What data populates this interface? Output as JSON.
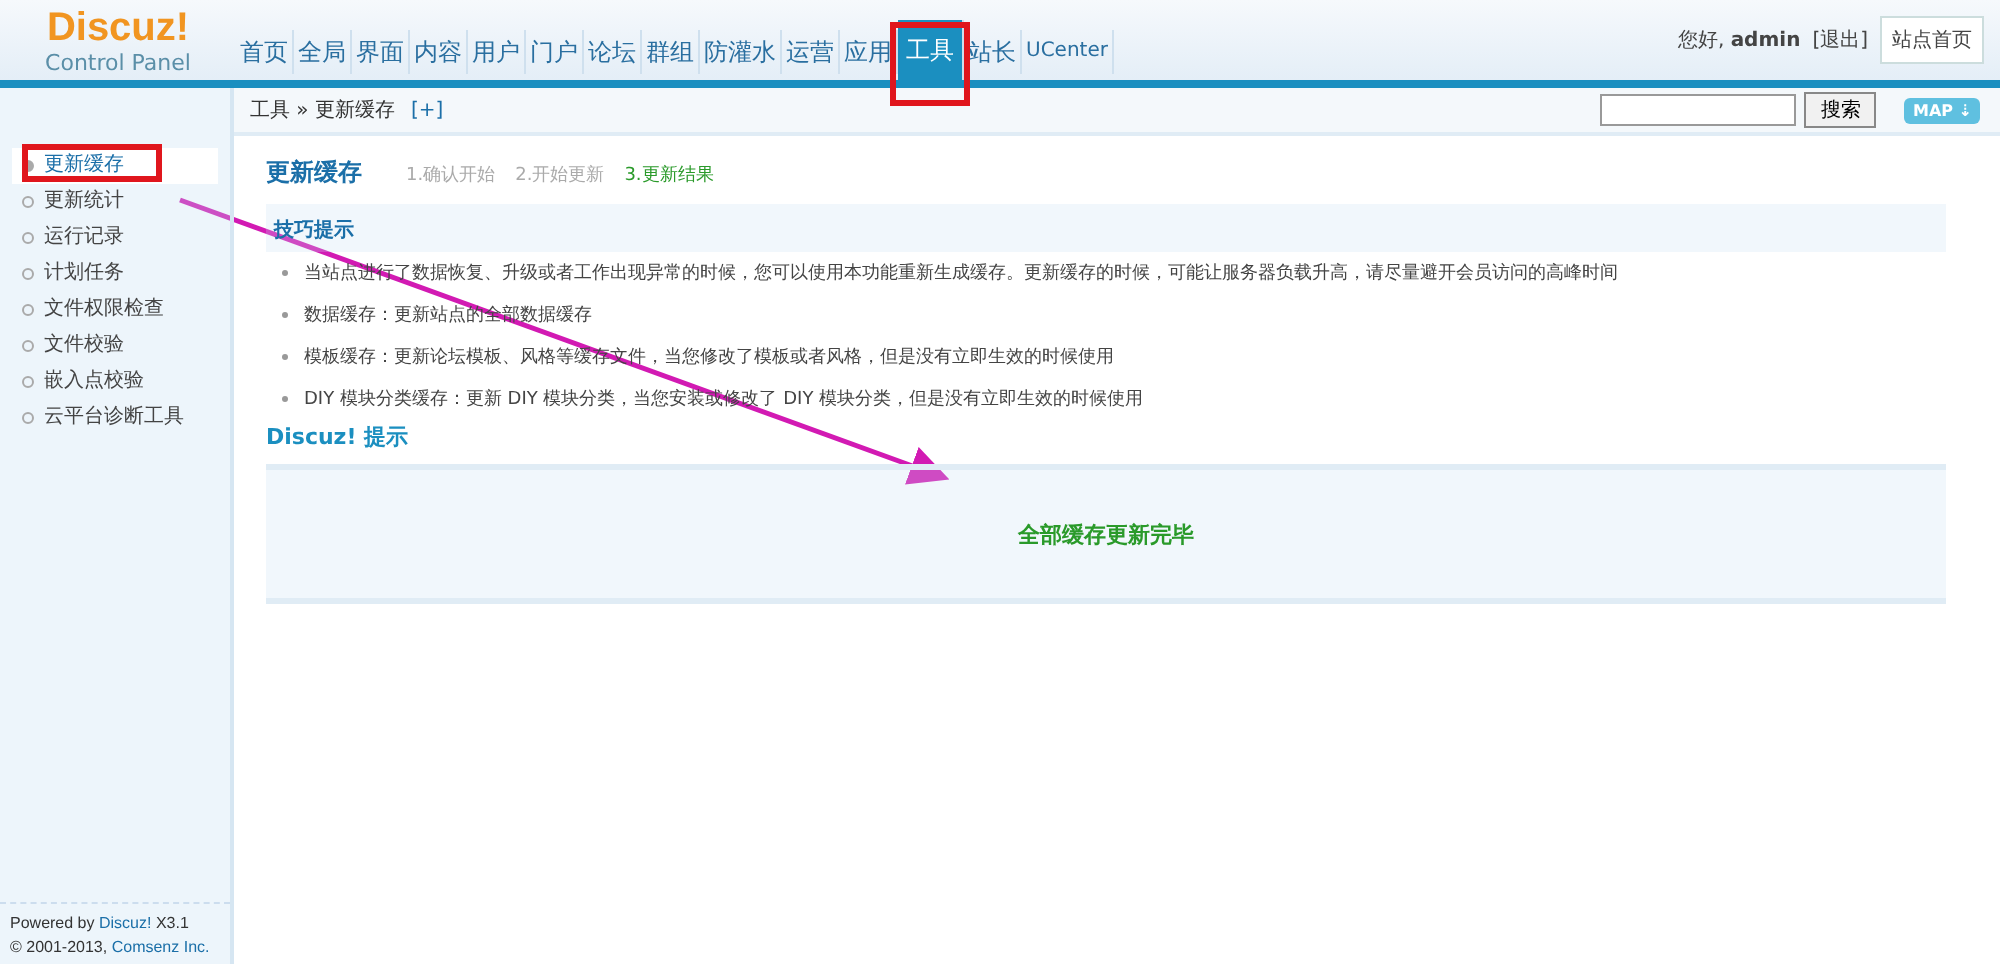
{
  "logo": {
    "name": "Discuz!",
    "subtitle": "Control Panel"
  },
  "nav": [
    {
      "label": "首页",
      "selected": false
    },
    {
      "label": "全局",
      "selected": false
    },
    {
      "label": "界面",
      "selected": false
    },
    {
      "label": "内容",
      "selected": false
    },
    {
      "label": "用户",
      "selected": false
    },
    {
      "label": "门户",
      "selected": false
    },
    {
      "label": "论坛",
      "selected": false
    },
    {
      "label": "群组",
      "selected": false
    },
    {
      "label": "防灌水",
      "selected": false
    },
    {
      "label": "运营",
      "selected": false
    },
    {
      "label": "应用",
      "selected": false
    },
    {
      "label": "工具",
      "selected": true
    },
    {
      "label": "站长",
      "selected": false
    },
    {
      "label": "UCenter",
      "selected": false
    }
  ],
  "user": {
    "greeting": "您好,",
    "name": "admin",
    "logout": "[退出]",
    "home_button": "站点首页"
  },
  "breadcrumb": {
    "path": "工具 » 更新缓存",
    "toggle": "[+]"
  },
  "search": {
    "button": "搜索",
    "map": "MAP ⇣"
  },
  "sidebar": {
    "items": [
      {
        "label": "更新缓存",
        "selected": true
      },
      {
        "label": "更新统计",
        "selected": false
      },
      {
        "label": "运行记录",
        "selected": false
      },
      {
        "label": "计划任务",
        "selected": false
      },
      {
        "label": "文件权限检查",
        "selected": false
      },
      {
        "label": "文件校验",
        "selected": false
      },
      {
        "label": "嵌入点校验",
        "selected": false
      },
      {
        "label": "云平台诊断工具",
        "selected": false
      }
    ],
    "footer": {
      "powered": "Powered by",
      "brand": "Discuz!",
      "version": "X3.1",
      "copyright": "© 2001-2013,",
      "company": "Comsenz Inc."
    }
  },
  "main": {
    "title": "更新缓存",
    "steps": [
      {
        "label": "1.确认开始",
        "selected": false
      },
      {
        "label": "2.开始更新",
        "selected": false
      },
      {
        "label": "3.更新结果",
        "selected": true
      }
    ],
    "tips_title": "技巧提示",
    "tips": [
      "当站点进行了数据恢复、升级或者工作出现异常的时候，您可以使用本功能重新生成缓存。更新缓存的时候，可能让服务器负载升高，请尽量避开会员访问的高峰时间",
      "数据缓存：更新站点的全部数据缓存",
      "模板缓存：更新论坛模板、风格等缓存文件，当您修改了模板或者风格，但是没有立即生效的时候使用",
      "DIY 模块分类缓存：更新  DIY 模块分类，当您安装或修改了  DIY 模块分类，但是没有立即生效的时候使用"
    ],
    "notice_title": "Discuz! 提示",
    "notice_message": "全部缓存更新完毕"
  }
}
